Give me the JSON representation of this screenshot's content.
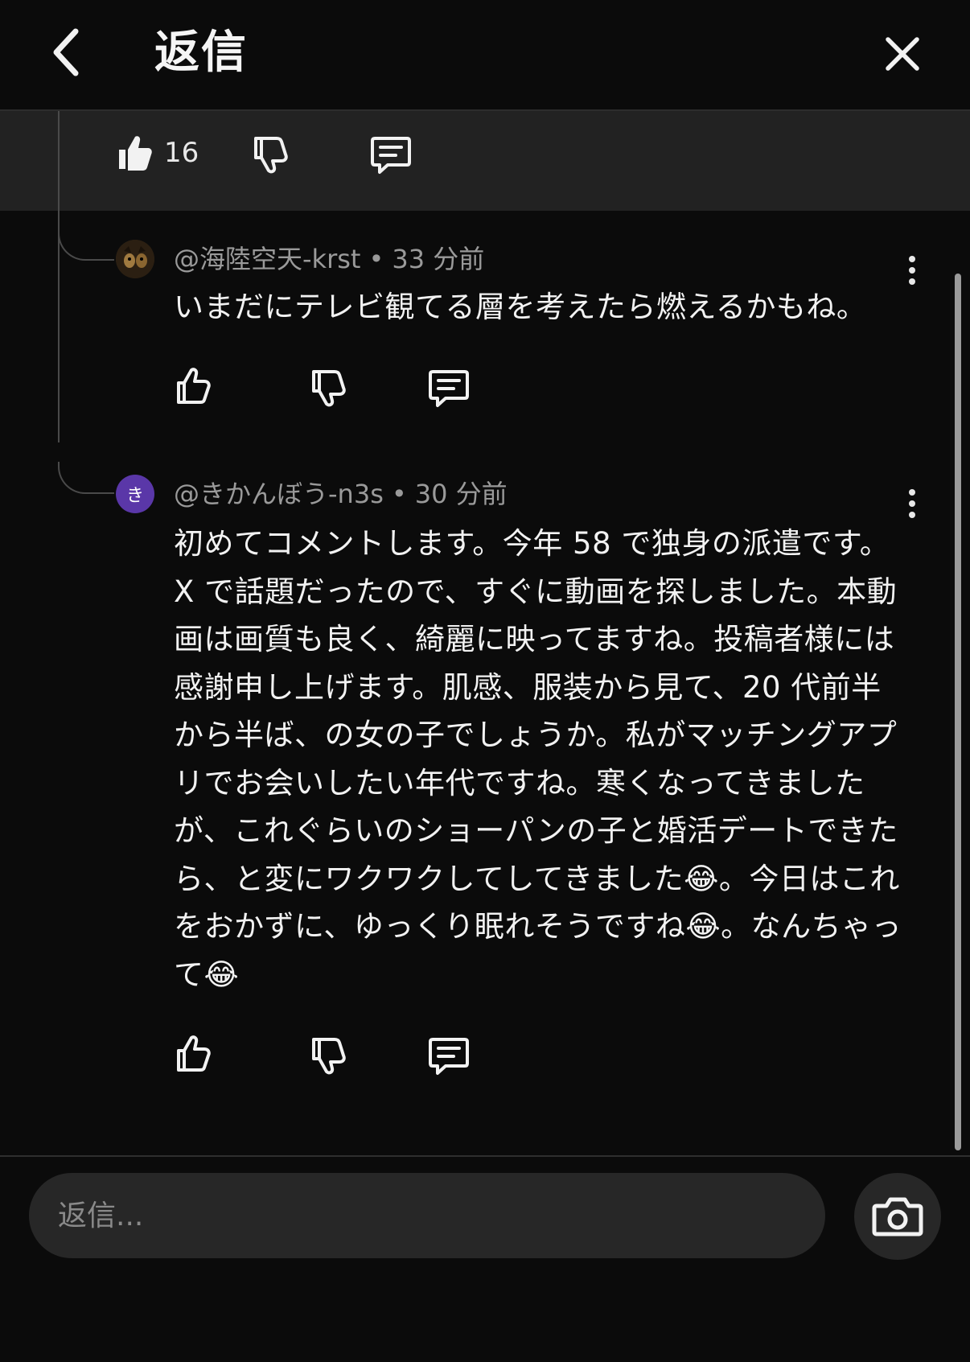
{
  "header": {
    "title": "返信"
  },
  "parent_comment": {
    "like_count": "16"
  },
  "replies": [
    {
      "author": "@海陸空天-krst",
      "separator": "•",
      "time": "33 分前",
      "body": "いまだにテレビ観てる層を考えたら燃えるかもね。"
    },
    {
      "avatar_letter": "き",
      "author": "@きかんぼう-n3s",
      "separator": "•",
      "time": "30 分前",
      "body": "初めてコメントします。今年 58 で独身の派遣です。X で話題だったので、すぐに動画を探しました。本動画は画質も良く、綺麗に映ってますね。投稿者様には感謝申し上げます。肌感、服装から見て、20 代前半から半ば、の女の子でしょうか。私がマッチングアプリでお会いしたい年代ですね。寒くなってきましたが、これぐらいのショーパンの子と婚活デートできたら、と変にワクワクしてしてきました😂。今日はこれをおかずに、ゆっくり眠れそうですね😂。なんちゃって😂"
    }
  ],
  "composer": {
    "placeholder": "返信..."
  },
  "colors": {
    "background": "#0b0b0b",
    "parent_bar": "#222222",
    "avatar_purple": "#5a37a8"
  }
}
